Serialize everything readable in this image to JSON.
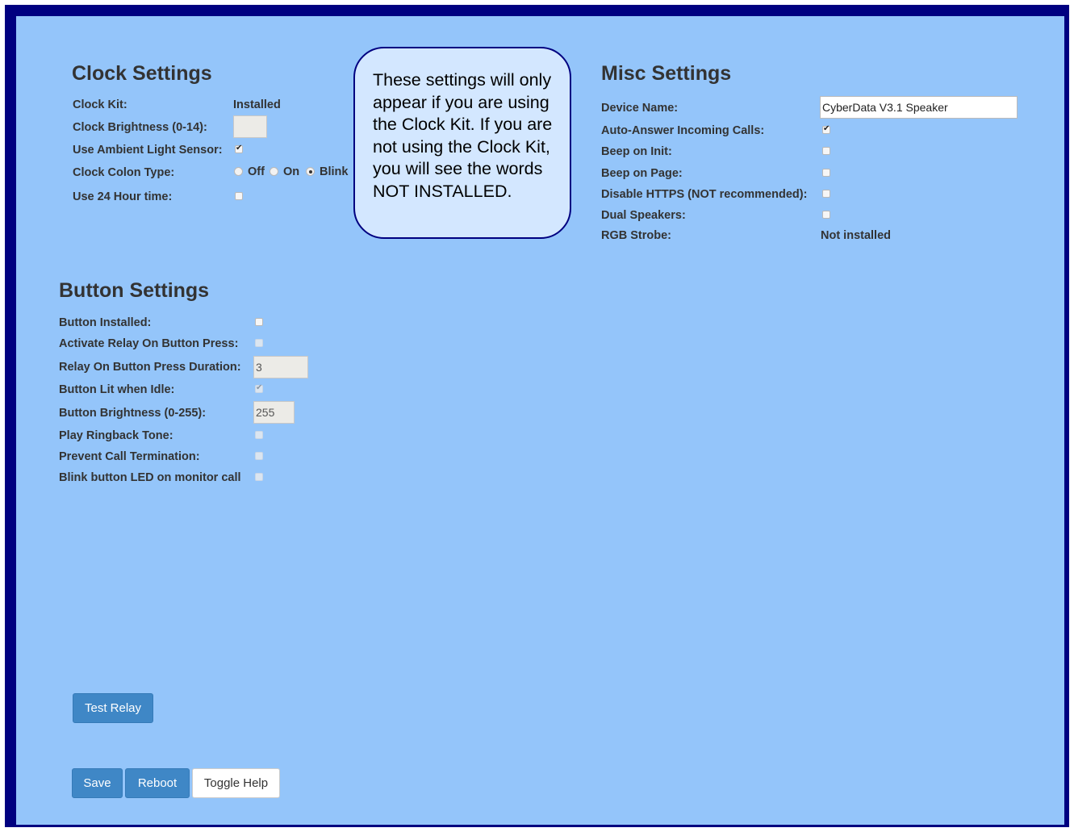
{
  "clock": {
    "title": "Clock Settings",
    "kit_label": "Clock Kit:",
    "kit_value": "Installed",
    "brightness_label": "Clock Brightness (0-14):",
    "brightness_value": "",
    "ambient_label": "Use Ambient Light Sensor:",
    "ambient_checked": true,
    "colon_label": "Clock Colon Type:",
    "colon_options": [
      "Off",
      "On",
      "Blink"
    ],
    "colon_selected": "Blink",
    "hour24_label": "Use 24 Hour time:",
    "hour24_checked": false
  },
  "help_bubble": {
    "text": "These settings will only appear if you are using the Clock Kit. If you are not using the Clock Kit, you will see the words NOT INSTALLED."
  },
  "misc": {
    "title": "Misc Settings",
    "device_name_label": "Device Name:",
    "device_name_value": "CyberData V3.1 Speaker",
    "auto_answer_label": "Auto-Answer Incoming Calls:",
    "auto_answer_checked": true,
    "beep_init_label": "Beep on Init:",
    "beep_init_checked": false,
    "beep_page_label": "Beep on Page:",
    "beep_page_checked": false,
    "disable_https_label": "Disable HTTPS (NOT recommended):",
    "disable_https_checked": false,
    "dual_speakers_label": "Dual Speakers:",
    "dual_speakers_checked": false,
    "rgb_strobe_label": "RGB Strobe:",
    "rgb_strobe_value": "Not installed"
  },
  "button": {
    "title": "Button Settings",
    "installed_label": "Button Installed:",
    "installed_checked": false,
    "relay_press_label": "Activate Relay On Button Press:",
    "relay_press_checked": false,
    "relay_duration_label": "Relay On Button Press Duration:",
    "relay_duration_value": "3",
    "lit_idle_label": "Button Lit when Idle:",
    "lit_idle_checked": true,
    "brightness_label": "Button Brightness (0-255):",
    "brightness_value": "255",
    "ringback_label": "Play Ringback Tone:",
    "ringback_checked": false,
    "prevent_term_label": "Prevent Call Termination:",
    "prevent_term_checked": false,
    "blink_led_label": "Blink button LED on monitor call",
    "blink_led_checked": false
  },
  "actions": {
    "test_relay": "Test Relay",
    "save": "Save",
    "reboot": "Reboot",
    "toggle_help": "Toggle Help"
  },
  "colors": {
    "frame": "#000080",
    "panel": "#94c5fa",
    "bubble": "#d3e7ff",
    "button_primary": "#3f87c6"
  }
}
